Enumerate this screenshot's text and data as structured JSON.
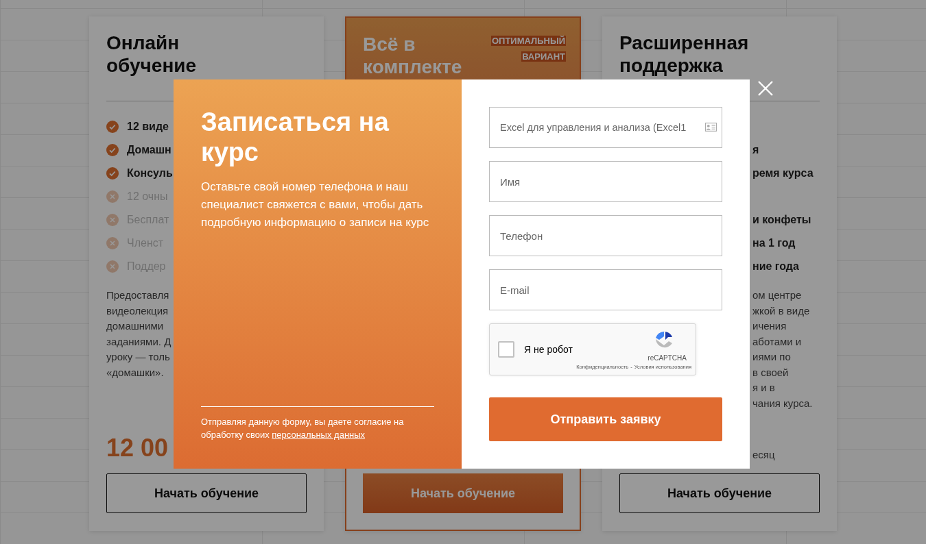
{
  "plans": [
    {
      "kind": "basic",
      "title": "Онлайн обучение",
      "features": [
        {
          "text": "12 виде",
          "included": true
        },
        {
          "text": "Домашн",
          "included": true
        },
        {
          "text": "Консуль",
          "included": true
        },
        {
          "text": "12 очны",
          "included": false
        },
        {
          "text": "Бесплат",
          "included": false
        },
        {
          "text": "Членст",
          "included": false
        },
        {
          "text": "Поддер",
          "included": false
        }
      ],
      "description_lines": [
        "Предоставля",
        "видеолекция",
        "домашними",
        "заданиями. Д",
        "уроку — толь",
        "«домашки»."
      ],
      "price": "12 00",
      "button": "Начать обучение"
    },
    {
      "kind": "featured",
      "title": "Всё в комплекте",
      "badge": "ОПТИМАЛЬНЫЙ ВАРИАНТ",
      "button": "Начать обучение"
    },
    {
      "kind": "extended",
      "title": "Расширенная поддержка",
      "feature_fragments": [
        "я",
        "ремя курса",
        "и конфеты",
        "на 1 год",
        "ние года"
      ],
      "description_fragments": [
        "ом центре",
        "жкой в виде",
        "ичения",
        "аботами и",
        "иями по",
        "в своей",
        "я и в",
        "чания курса."
      ],
      "price_note": "есяц",
      "button": "Начать обучение"
    }
  ],
  "modal": {
    "title": "Записаться на курс",
    "text": "Оставьте свой номер телефона и наш специалист свяжется с вами, чтобы дать подробную информацию о записи на курс",
    "consent": "Отправляя данную форму, вы даете согласие на обработку своих",
    "consent_link": "персональных данных",
    "fields": [
      {
        "kind": "course",
        "placeholder": "Excel для управления и анализа (Excel1"
      },
      {
        "kind": "text",
        "placeholder": "Имя"
      },
      {
        "kind": "text",
        "placeholder": "Телефон"
      },
      {
        "kind": "text",
        "placeholder": "E-mail"
      }
    ],
    "captcha": {
      "label": "Я не робот",
      "checked": false,
      "brand": "reCAPTCHA",
      "privacy_link": "Конфиденциальность",
      "separator": "-",
      "terms_link": "Условия использования"
    },
    "submit": "Отправить заявку"
  }
}
